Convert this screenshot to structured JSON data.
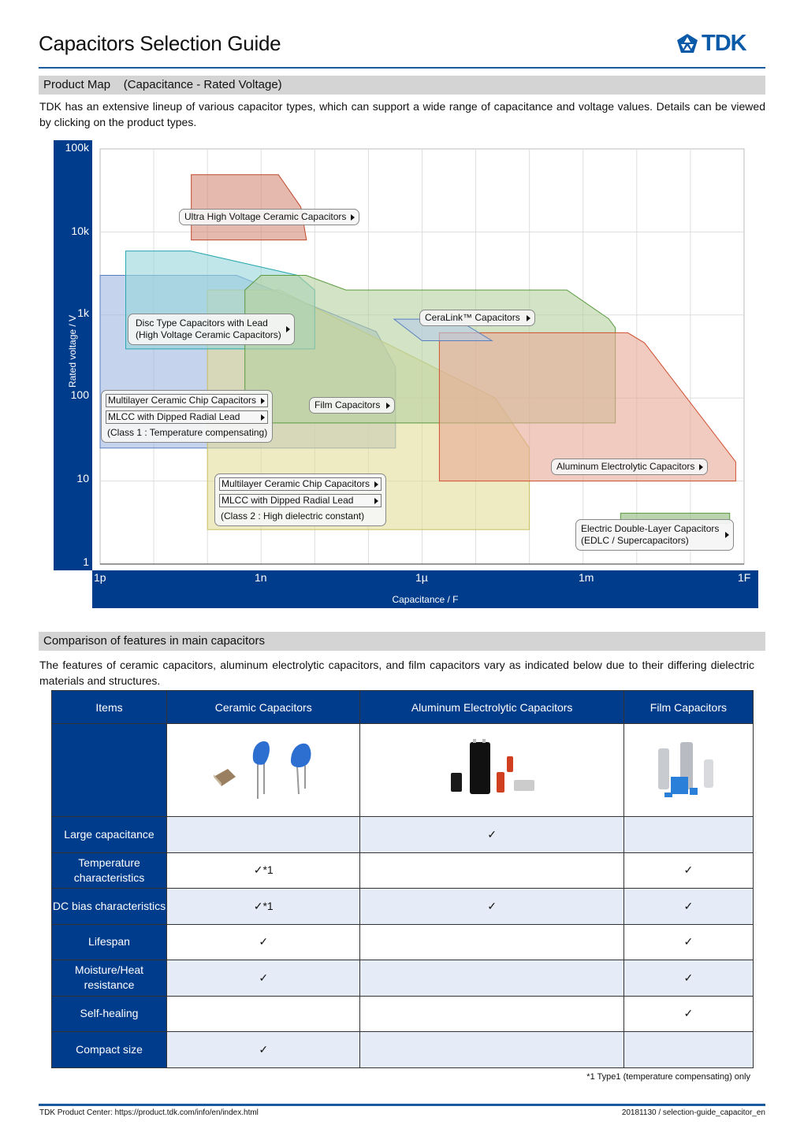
{
  "header": {
    "title": "Capacitors Selection Guide",
    "logo_text": "TDK"
  },
  "section1": {
    "title": "Product Map",
    "subtitle": "(Capacitance - Rated Voltage)",
    "description": "TDK has an extensive lineup of various capacitor types, which can support a wide range of capacitance and voltage values. Details can be viewed by clicking on the product types."
  },
  "chart_data": {
    "type": "area",
    "xlabel": "Capacitance / F",
    "ylabel": "Rated voltage  / V",
    "xscale": "log",
    "yscale": "log",
    "xlim": [
      1e-12,
      1
    ],
    "ylim": [
      1,
      100000
    ],
    "grid": true,
    "xticks": [
      "1p",
      "1n",
      "1µ",
      "1m",
      "1F"
    ],
    "yticks": [
      "100k",
      "10k",
      "1k",
      "100",
      "10",
      "1"
    ],
    "regions": [
      {
        "product": "MLCC class 1",
        "color": "#9fb6df",
        "stroke": "#5a7fc0",
        "points": [
          [
            1e-12,
            3000
          ],
          [
            3.5e-10,
            3000
          ],
          [
            1.4e-07,
            630
          ],
          [
            3.2e-07,
            235
          ],
          [
            3.2e-07,
            25
          ],
          [
            1e-12,
            25
          ]
        ]
      },
      {
        "product": "MLCC class 2",
        "color": "#e2dc9a",
        "stroke": "#c8c060",
        "points": [
          [
            1e-10,
            2000
          ],
          [
            2.2e-09,
            2000
          ],
          [
            2.3e-05,
            100
          ],
          [
            0.0001,
            25
          ],
          [
            0.0001,
            2.6
          ],
          [
            1e-10,
            2.6
          ]
        ]
      },
      {
        "product": "Disc Type",
        "color": "#96d6dc",
        "stroke": "#2aa8b0",
        "points": [
          [
            3e-12,
            5900
          ],
          [
            4.8e-11,
            5900
          ],
          [
            4.8e-09,
            3000
          ],
          [
            1e-08,
            2000
          ],
          [
            1e-08,
            390
          ],
          [
            3e-12,
            390
          ]
        ]
      },
      {
        "product": "Film",
        "color": "#b5d19e",
        "stroke": "#5a9a40",
        "points": [
          [
            5e-10,
            2000
          ],
          [
            1e-09,
            3000
          ],
          [
            6.9e-09,
            3000
          ],
          [
            3.8e-08,
            2000
          ],
          [
            0.0005,
            2000
          ],
          [
            0.003,
            900
          ],
          [
            0.004,
            700
          ],
          [
            0.004,
            50
          ],
          [
            5e-10,
            50
          ]
        ]
      },
      {
        "product": "Aluminum Electrolytic",
        "color": "#e8a894",
        "stroke": "#d05030",
        "points": [
          [
            2.1e-06,
            610
          ],
          [
            0.0068,
            610
          ],
          [
            0.014,
            460
          ],
          [
            0.7,
            17
          ],
          [
            0.7,
            10
          ],
          [
            2.1e-06,
            10
          ]
        ]
      },
      {
        "product": "Ultra High Voltage",
        "color": "#d48a76",
        "stroke": "#c0452a",
        "points": [
          [
            5e-11,
            49000
          ],
          [
            2.1e-09,
            49000
          ],
          [
            5.5e-09,
            20000
          ],
          [
            7e-09,
            8000
          ],
          [
            5e-11,
            8000
          ]
        ]
      },
      {
        "product": "CeraLink",
        "color": "#b8cce8",
        "stroke": "#5a7fc0",
        "points": [
          [
            3e-07,
            890
          ],
          [
            4.4e-06,
            890
          ],
          [
            2e-05,
            490
          ],
          [
            1e-06,
            490
          ]
        ]
      },
      {
        "product": "EDLC",
        "color": "#8ab878",
        "stroke": "#5a9a40",
        "points": [
          [
            0.005,
            4.1
          ],
          [
            0.54,
            4.1
          ],
          [
            0.54,
            3.1
          ],
          [
            0.005,
            3.1
          ]
        ]
      }
    ],
    "labels": {
      "uhv": "Ultra High Voltage Ceramic Capacitors",
      "disc1": "Disc Type Capacitors with Lead",
      "disc2": "(High Voltage Ceramic Capacitors)",
      "c1_mlcc": "Multilayer Ceramic Chip Capacitors",
      "c1_dipped": "MLCC with Dipped Radial Lead",
      "c1_note": "(Class 1 : Temperature compensating)",
      "film": "Film Capacitors",
      "ceralink": "CeraLink™ Capacitors",
      "al": "Aluminum Electrolytic Capacitors",
      "c2_mlcc": "Multilayer Ceramic Chip Capacitors",
      "c2_dipped": "MLCC with Dipped Radial Lead",
      "c2_note": "(Class 2 : High dielectric constant)",
      "edlc1": "Electric Double-Layer Capacitors",
      "edlc2": "(EDLC / Supercapacitors)"
    }
  },
  "section2": {
    "title": "Comparison of features in main capacitors",
    "description": "The features of ceramic capacitors, aluminum electrolytic capacitors, and film capacitors vary as indicated below due to their differing dielectric materials and structures."
  },
  "table": {
    "headers": [
      "Items",
      "Ceramic Capacitors",
      "Aluminum Electrolytic Capacitors",
      "Film Capacitors"
    ],
    "rows": [
      {
        "item": "Large capacitance",
        "values": [
          "",
          "✓",
          ""
        ]
      },
      {
        "item": "Temperature characteristics",
        "values": [
          "✓*1",
          "",
          "✓"
        ]
      },
      {
        "item": "DC bias characteristics",
        "values": [
          "✓*1",
          "✓",
          "✓"
        ]
      },
      {
        "item": "Lifespan",
        "values": [
          "✓",
          "",
          "✓"
        ]
      },
      {
        "item": "Moisture/Heat resistance",
        "values": [
          "✓",
          "",
          "✓"
        ]
      },
      {
        "item": "Self-healing",
        "values": [
          "",
          "",
          "✓"
        ]
      },
      {
        "item": "Compact size",
        "values": [
          "✓",
          "",
          ""
        ]
      }
    ],
    "footnote": "*1 Type1 (temperature compensating) only"
  },
  "footer": {
    "left": "TDK Product Center: https://product.tdk.com/info/en/index.html",
    "right": "20181130 / selection-guide_capacitor_en"
  }
}
